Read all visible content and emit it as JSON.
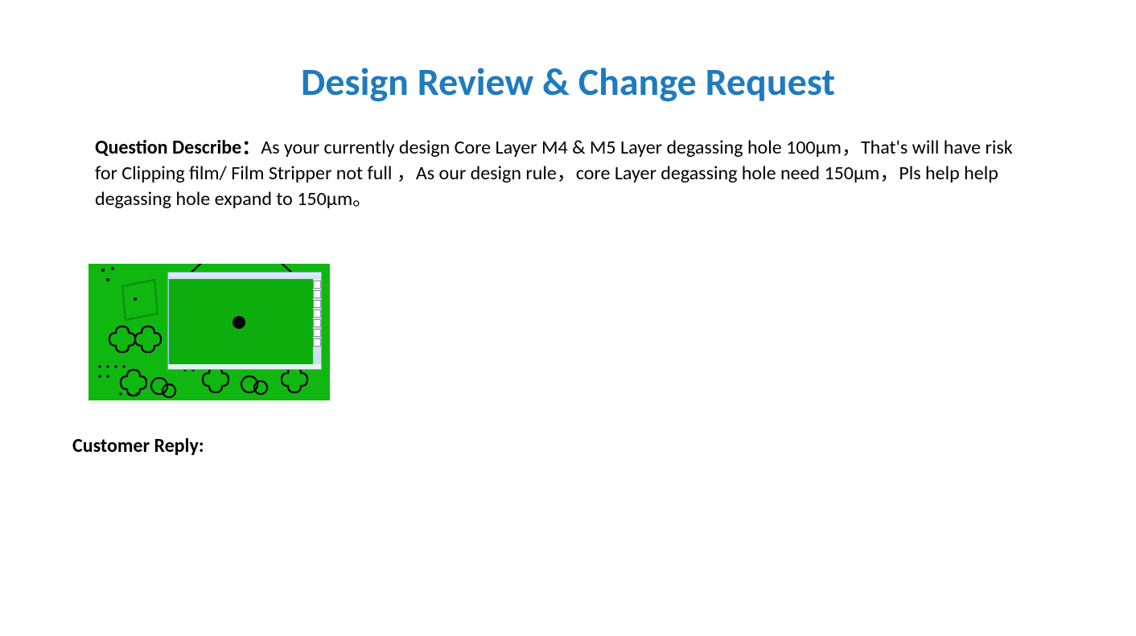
{
  "title": "Design Review & Change Request",
  "question": {
    "label": "Question Describe：",
    "body": "As your currently design Core Layer M4 & M5 Layer degassing hole 100μm，That's will have risk for Clipping film/ Film Stripper not full ，As our design rule，core Layer degassing hole need 150μm，Pls help help degassing hole expand to 150μm。"
  },
  "reply": {
    "label": "Customer Reply:",
    "body": ""
  },
  "figure": {
    "description": "CAD layout screenshot: green copper plane with black degassing-hole outlines; a small CAD viewer window overlay shows a single black round hole centred on green.",
    "colors": {
      "copper_plane": "#11b711",
      "hole_outline": "#000000",
      "window_chrome": "#c9e0ee"
    }
  }
}
